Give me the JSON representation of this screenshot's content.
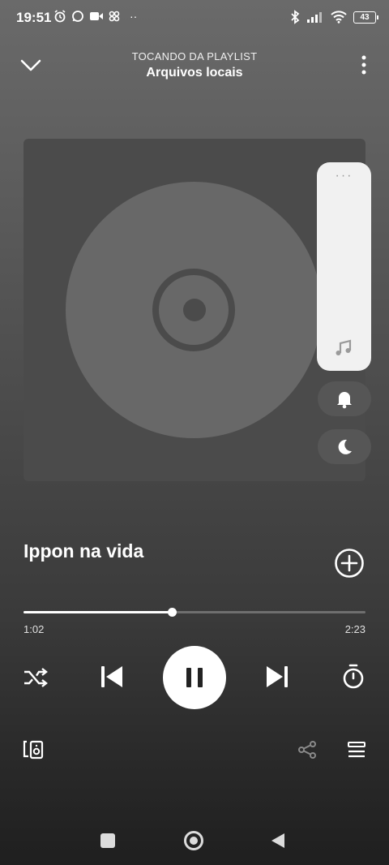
{
  "status_bar": {
    "time": "19:51",
    "battery": "43",
    "icons": [
      "alarm-icon",
      "whatsapp-icon",
      "video-icon",
      "app-icon",
      "more-dots-icon",
      "bluetooth-icon",
      "signal-icon",
      "wifi-icon",
      "battery-icon"
    ]
  },
  "header": {
    "subtitle": "TOCANDO DA PLAYLIST",
    "title": "Arquivos locais"
  },
  "side_panel": {
    "dots": "···",
    "icons": [
      "music-note-icon",
      "bell-icon",
      "moon-icon"
    ]
  },
  "track": {
    "title": "Ippon na vida"
  },
  "progress": {
    "current": "1:02",
    "total": "2:23",
    "fraction": 0.434
  },
  "controls": [
    "shuffle-icon",
    "previous-icon",
    "pause-icon",
    "next-icon",
    "sleep-timer-icon"
  ],
  "bottom_actions": [
    "connect-device-icon",
    "share-icon",
    "queue-icon"
  ],
  "nav_bar": [
    "recents-button",
    "home-button",
    "back-button"
  ]
}
